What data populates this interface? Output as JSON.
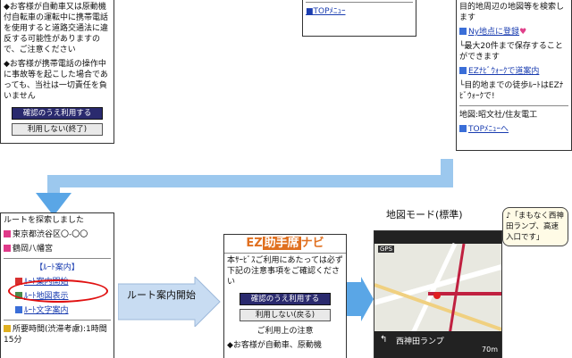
{
  "panel1": {
    "lines": [
      "◆お客様が自動車又は原動機付自転車の運転中に携帯電話を使用すると道路交通法に違反する可能性がありますので、ご注意ください",
      "◆お客様が携帯電話の操作中に事故等を起こした場合であっても、当社は一切責任を負いません"
    ],
    "btn_accept": "確認のうえ利用する",
    "btn_decline": "利用しない(終了)"
  },
  "panel2": {
    "top_link": "■TOPﾒﾆｭｰ"
  },
  "panel3": {
    "lines_top": [
      "目的地周辺の地図等を検索します"
    ],
    "link_register": "Ny地点に登録",
    "note_register": "└最大20件まで保存することができます",
    "link_navi": "EZﾅﾋﾞｳｫｰｸで道案内",
    "note_navi": "└目的地までの徒歩ﾙｰﾄはEZﾅﾋﾞｳｫｰｸで!",
    "map_label": "地図:昭文社/住友電工",
    "top_link": "TOPﾒﾆｭｰへ"
  },
  "panel4": {
    "line1": "ルートを探索しました",
    "from": "東京都渋谷区〇-〇〇",
    "to": "鶴岡八幡宮",
    "section": "【ﾙｰﾄ案内】",
    "link_guide": "ﾙｰﾄ案内開始",
    "link_map": "ﾙｰﾄ地図表示",
    "link_text": "ﾙｰﾄ文字案内",
    "time_label": "所要時間(渋滞考慮):1時間15分"
  },
  "arrow_label": "ルート案内開始",
  "panel5": {
    "logo_ez": "EZ",
    "logo_mid": "助手席",
    "logo_navi": "ナビ",
    "intro": "本ｻｰﾋﾞｽご利用にあたっては必ず下記の注意事項をご確認ください",
    "btn_accept": "確認のうえ利用する",
    "btn_decline": "利用しない(戻る)",
    "notice_title": "ご利用上の注意",
    "notice_line": "◆お客様が自動車、原動機"
  },
  "map_mode_label": "地図モード(標準)",
  "panel6": {
    "road": "西神田ランプ",
    "distance": "70m",
    "bubble": "♪「まもなく西神田ランプ、高速入口です」",
    "gps": "GPS"
  },
  "colors": {
    "link": "#1a3db0",
    "arrow": "#3a8fd8",
    "highlight": "#e01010"
  }
}
